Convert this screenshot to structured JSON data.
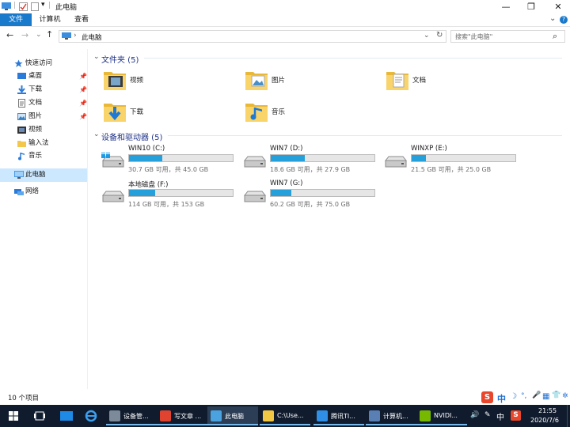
{
  "window": {
    "title": "此电脑",
    "qa_dropdown": "▾",
    "btn_min": "—",
    "btn_max": "❐",
    "btn_close": "✕",
    "ribbon_toggle": "⌄",
    "help": "?"
  },
  "ribbon": {
    "tabs": [
      "文件",
      "计算机",
      "查看"
    ]
  },
  "address": {
    "back": "←",
    "forward": "→",
    "history": "⌄",
    "up": "↑",
    "path": "此电脑",
    "sep": "›",
    "dropdown": "⌄",
    "refresh": "↻",
    "search_placeholder": "搜索\"此电脑\"",
    "search_glyph": "⌕"
  },
  "nav": {
    "items": [
      {
        "label": "快速访问",
        "icon": "star-icon",
        "pinned": false
      },
      {
        "label": "桌面",
        "icon": "desktop-icon",
        "pinned": true
      },
      {
        "label": "下载",
        "icon": "download-icon",
        "pinned": true
      },
      {
        "label": "文档",
        "icon": "document-icon",
        "pinned": true
      },
      {
        "label": "图片",
        "icon": "picture-icon",
        "pinned": true
      },
      {
        "label": "视频",
        "icon": "video-icon",
        "pinned": false
      },
      {
        "label": "输入法",
        "icon": "folder-icon",
        "pinned": false
      },
      {
        "label": "音乐",
        "icon": "music-icon",
        "pinned": false
      },
      {
        "label": "此电脑",
        "icon": "computer-icon",
        "pinned": false,
        "selected": true
      },
      {
        "label": "网络",
        "icon": "network-icon",
        "pinned": false
      }
    ],
    "pin_glyph": "📌"
  },
  "folders": {
    "header": "文件夹 (5)",
    "items": [
      "视频",
      "图片",
      "文档",
      "下载",
      "音乐"
    ]
  },
  "drives": {
    "header": "设备和驱动器 (5)",
    "items": [
      {
        "name": "WIN10 (C:)",
        "free": "30.7 GB 可用，共 45.0 GB",
        "used_fraction": 0.32,
        "windows": true
      },
      {
        "name": "WIN7 (D:)",
        "free": "18.6 GB 可用，共 27.9 GB",
        "used_fraction": 0.33,
        "windows": false
      },
      {
        "name": "WINXP (E:)",
        "free": "21.5 GB 可用，共 25.0 GB",
        "used_fraction": 0.14,
        "windows": false
      },
      {
        "name": "本地磁盘 (F:)",
        "free": "114 GB 可用，共 153 GB",
        "used_fraction": 0.25,
        "windows": false
      },
      {
        "name": "WIN7 (G:)",
        "free": "60.2 GB 可用，共 75.0 GB",
        "used_fraction": 0.2,
        "windows": false
      }
    ]
  },
  "status": {
    "count": "10 个项目"
  },
  "taskbar": {
    "apps": [
      {
        "label": "设备管...",
        "color": "#7d8a99"
      },
      {
        "label": "写文章 ...",
        "color": "#e0432f"
      },
      {
        "label": "此电脑",
        "color": "#4aa3df",
        "active": true
      },
      {
        "label": "C:\\Use...",
        "color": "#f2c744"
      },
      {
        "label": "腾讯TI...",
        "color": "#2f8fe6"
      },
      {
        "label": "计算机...",
        "color": "#5a7fb5"
      },
      {
        "label": "NVIDI...",
        "color": "#76b900"
      }
    ],
    "tray": {
      "volume": "🔊",
      "pen": "✎",
      "ime": "中",
      "sogou": "S",
      "time": "21:55",
      "date": "2020/7/6"
    },
    "ime_bar": {
      "logo": "S",
      "lang": "中",
      "moon": "☽",
      "dot": "°,",
      "mic": "🎤",
      "grid": "▦",
      "shirt": "👕",
      "tools": "✲"
    }
  },
  "colors": {
    "accent": "#1979ca",
    "drive_fill": "#26a0da",
    "taskbar": "#101c2e",
    "selected_nav": "#cce8ff"
  }
}
